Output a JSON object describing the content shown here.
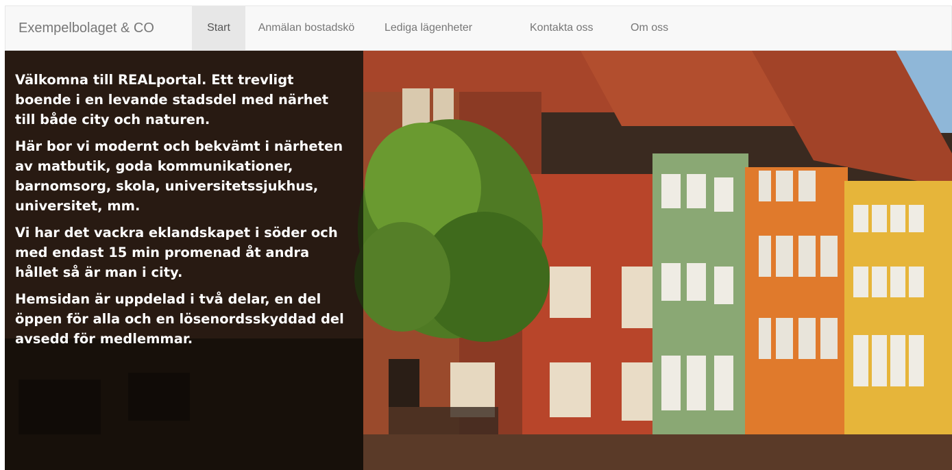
{
  "navbar": {
    "brand": "Exempelbolaget & CO",
    "items": [
      {
        "label": "Start",
        "active": true
      },
      {
        "label": "Anmälan bostadskö",
        "active": false
      },
      {
        "label": "Lediga lägenheter",
        "active": false
      },
      {
        "label": "Kontakta oss",
        "active": false
      },
      {
        "label": "Om oss",
        "active": false
      }
    ]
  },
  "hero": {
    "paragraphs": [
      "Välkomna till REALportal. Ett trevligt boende i en levande stadsdel med närhet till både city och naturen.",
      "Här bor vi modernt och bekvämt i närheten av matbutik, goda kommunikationer, barnomsorg, skola, universitetssjukhus, universitet, mm.",
      "Vi har det vackra eklandskapet i söder och med endast 15 min promenad åt andra hållet så är man i city.",
      "Hemsidan är uppdelad i två delar, en del öppen för alla och en lösenordsskyddad del avsedd för medlemmar."
    ]
  },
  "colors": {
    "navbar_bg": "#f8f8f8",
    "nav_text": "#777777",
    "nav_active_bg": "#e7e7e7",
    "overlay": "rgba(0,0,0,0.62)"
  }
}
